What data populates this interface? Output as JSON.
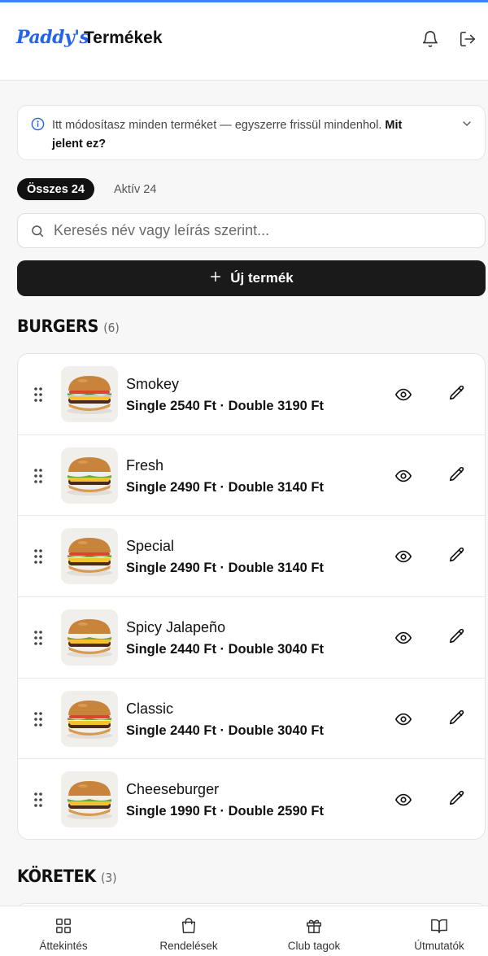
{
  "header": {
    "logo": "Paddy's",
    "title": "Termékek",
    "icons": [
      "bell-icon",
      "logout-icon"
    ]
  },
  "info": {
    "text": "Itt módosítasz minden terméket — egyszerre frissül mindenhol.",
    "link": "Mit jelent ez?"
  },
  "filters": {
    "all_label": "Összes 24",
    "active_label": "Aktív 24"
  },
  "search": {
    "placeholder": "Keresés név vagy leírás szerint..."
  },
  "new_button": {
    "label": "Új termék"
  },
  "sections": [
    {
      "title": "BURGERS",
      "count": "(6)",
      "items": [
        {
          "name": "Smokey",
          "price": "Single 2540 Ft · Double 3190 Ft"
        },
        {
          "name": "Fresh",
          "price": "Single 2490 Ft · Double 3140 Ft"
        },
        {
          "name": "Special",
          "price": "Single 2490 Ft · Double 3140 Ft"
        },
        {
          "name": "Spicy Jalapeño",
          "price": "Single 2440 Ft · Double 3040 Ft"
        },
        {
          "name": "Classic",
          "price": "Single 2440 Ft · Double 3040 Ft"
        },
        {
          "name": "Cheeseburger",
          "price": "Single 1990 Ft · Double 2590 Ft"
        }
      ]
    },
    {
      "title": "KÖRETEK",
      "count": "(3)"
    }
  ],
  "bottom_nav": [
    {
      "label": "Áttekintés",
      "icon": "dashboard-icon"
    },
    {
      "label": "Rendelések",
      "icon": "shopping-bag-icon"
    },
    {
      "label": "Club tagok",
      "icon": "gift-icon"
    },
    {
      "label": "Útmutatók",
      "icon": "book-icon"
    }
  ],
  "colors": {
    "accent": "#2563eb",
    "dark": "#1a1a1a"
  }
}
